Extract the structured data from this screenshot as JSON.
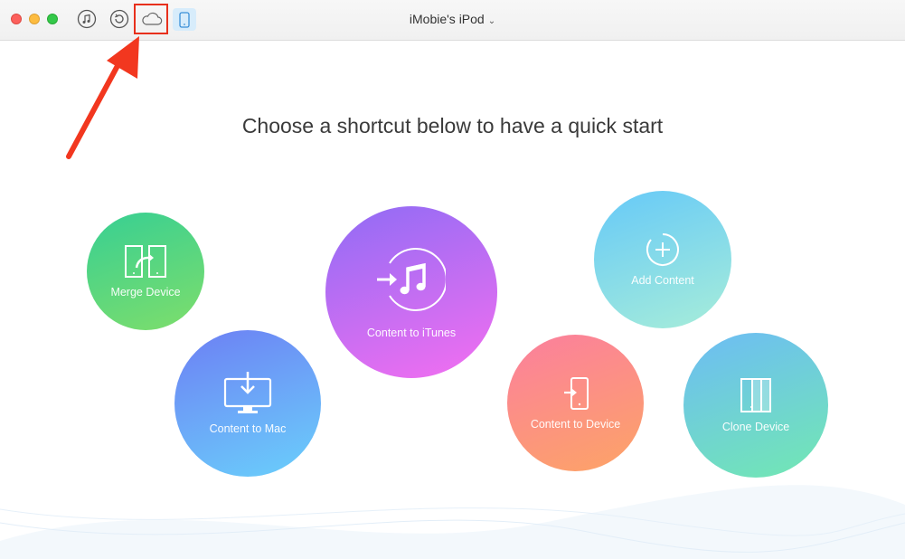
{
  "window": {
    "device_name": "iMobie's iPod",
    "dropdown_glyph": "⌄"
  },
  "toolbar": {
    "icons": [
      "itunes-music-icon",
      "backup-restore-icon",
      "icloud-icon",
      "device-icon"
    ],
    "highlight_color": "#e8301c"
  },
  "main": {
    "heading": "Choose a shortcut below to have a quick start"
  },
  "shortcuts": {
    "merge_device": "Merge Device",
    "content_to_mac": "Content to Mac",
    "content_to_itunes": "Content to iTunes",
    "add_content": "Add Content",
    "content_to_device": "Content to Device",
    "clone_device": "Clone Device"
  },
  "colors": {
    "merge_device": [
      "#37cf93",
      "#7ede6b"
    ],
    "content_to_mac": [
      "#6d7ff4",
      "#6ad0fb"
    ],
    "content_to_itunes": [
      "#8f6cf5",
      "#f46ff0"
    ],
    "add_content": [
      "#66c9f8",
      "#a7edd9"
    ],
    "content_to_device": [
      "#fb7f9e",
      "#fda466"
    ],
    "clone_device": [
      "#6dbcf5",
      "#72e8b2"
    ]
  }
}
